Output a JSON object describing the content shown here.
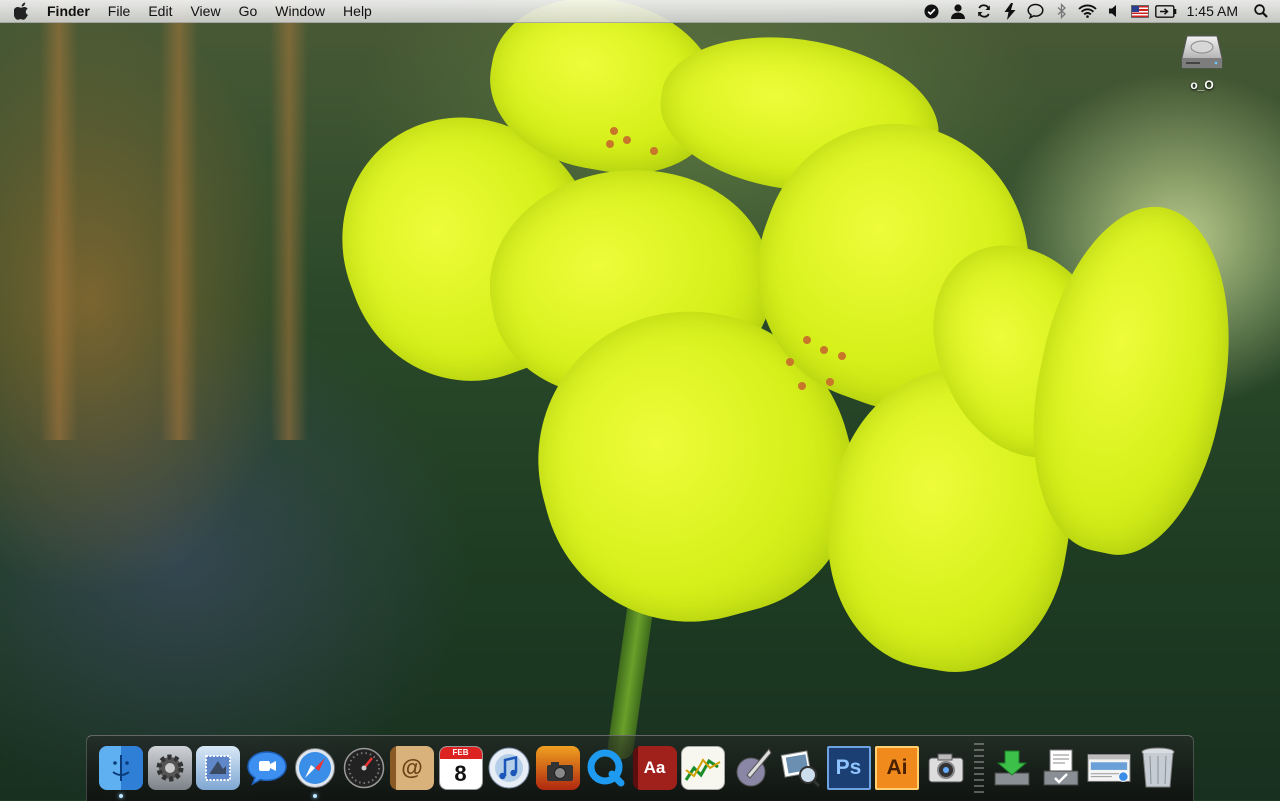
{
  "menubar": {
    "app_name": "Finder",
    "menus": [
      "File",
      "Edit",
      "View",
      "Go",
      "Window",
      "Help"
    ],
    "status_icons": [
      "check-circle-icon",
      "user-icon",
      "sync-icon",
      "bolt-icon",
      "chat-bubble-icon",
      "bluetooth-icon",
      "wifi-icon",
      "volume-icon",
      "us-flag-input-icon",
      "battery-icon"
    ],
    "clock": "1:45 AM"
  },
  "desktop": {
    "drive_label": "o_O"
  },
  "dock": {
    "apps": [
      {
        "name": "finder",
        "running": true
      },
      {
        "name": "system-preferences",
        "running": false
      },
      {
        "name": "mail",
        "running": false
      },
      {
        "name": "ichat",
        "running": false
      },
      {
        "name": "safari",
        "running": true
      },
      {
        "name": "dashboard",
        "running": false
      },
      {
        "name": "address-book",
        "running": false
      },
      {
        "name": "ical",
        "running": false
      },
      {
        "name": "itunes",
        "running": false
      },
      {
        "name": "photo-booth",
        "running": false
      },
      {
        "name": "quicktime",
        "running": false
      },
      {
        "name": "dictionary",
        "running": false
      },
      {
        "name": "grapher",
        "running": false
      },
      {
        "name": "script-editor",
        "running": false
      },
      {
        "name": "preview",
        "running": false
      },
      {
        "name": "photoshop",
        "running": false
      },
      {
        "name": "illustrator",
        "running": false
      },
      {
        "name": "image-capture",
        "running": false
      }
    ],
    "ical_month": "FEB",
    "ical_day": "8",
    "photoshop_label": "Ps",
    "illustrator_label": "Ai",
    "dictionary_label": "Aa",
    "address_book_label": "@",
    "stacks": [
      "downloads-stack",
      "documents-stack",
      "applications-stack"
    ]
  }
}
